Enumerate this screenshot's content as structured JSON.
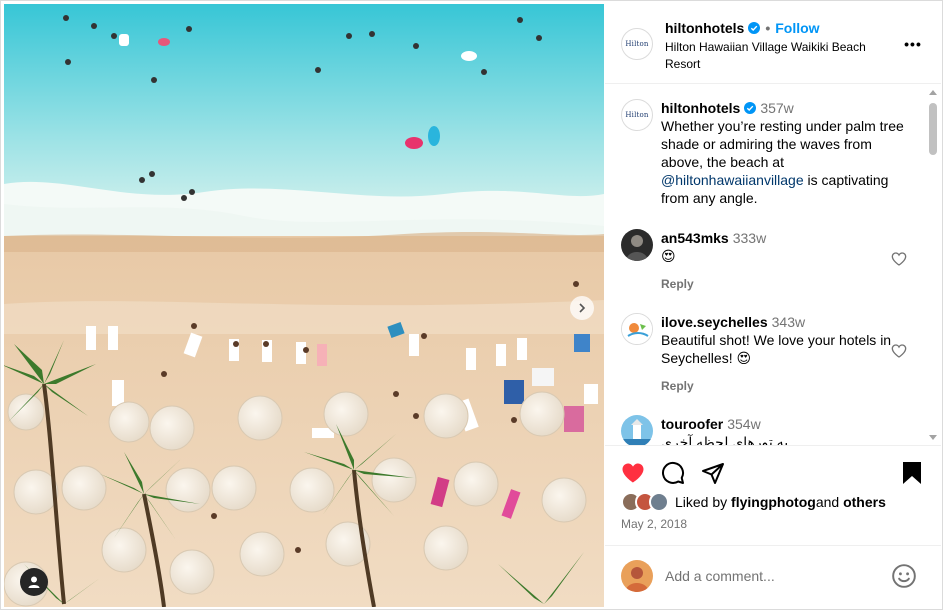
{
  "header": {
    "username": "hiltonhotels",
    "follow_label": "Follow",
    "location": "Hilton Hawaiian Village Waikiki Beach Resort",
    "dot": "•",
    "more_label": "•••"
  },
  "brand_logo_text": "Hilton",
  "caption": {
    "username": "hiltonhotels",
    "time": "357w",
    "text_before": "Whether you’re resting under palm tree shade or admiring the waves from above, the beach at ",
    "mention": "@hiltonhawaiianvillage",
    "text_after": " is captivating from any angle."
  },
  "comments": [
    {
      "username": "an543mks",
      "time": "333w",
      "text": "😍",
      "reply_label": "Reply"
    },
    {
      "username": "ilove.seychelles",
      "time": "343w",
      "text": "Beautiful shot! We love your hotels in Seychelles! 😍",
      "reply_label": "Reply"
    },
    {
      "username": "touroofer",
      "time": "354w",
      "text": "یه تورهای لحظه آخری"
    }
  ],
  "likes": {
    "prefix": "Liked by ",
    "user": "flyingphotog",
    "middle": " and ",
    "others": "others"
  },
  "date": "May 2, 2018",
  "add_comment": {
    "placeholder": "Add a comment..."
  },
  "icons": {
    "like": "heart-icon",
    "comment": "comment-icon",
    "share": "share-icon",
    "save": "bookmark-icon",
    "emoji": "emoji-icon",
    "next": "chevron-right-icon",
    "tag": "user-tag-icon",
    "verified": "verified-badge-icon"
  },
  "colors": {
    "accent": "#0095f6",
    "like_red": "#ff3040",
    "mention": "#00376b",
    "muted": "#737373"
  }
}
